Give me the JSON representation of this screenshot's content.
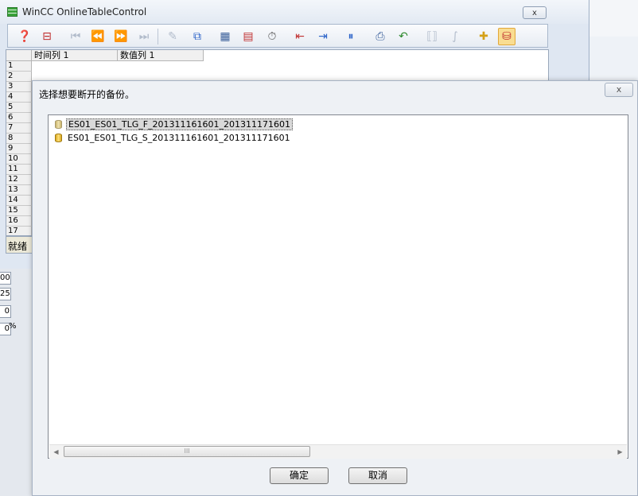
{
  "window": {
    "title": "WinCC OnlineTableControl",
    "close_label": "x"
  },
  "toolbar": {
    "icons": [
      "help-icon",
      "config-icon",
      "first-icon",
      "prev-page-icon",
      "next-page-icon",
      "last-icon",
      "edit-icon",
      "copy-icon",
      "select-columns-icon",
      "select-table-icon",
      "time-range-icon",
      "prev-column-icon",
      "next-column-icon",
      "pause-icon",
      "print-icon",
      "export-icon",
      "select-data-icon",
      "calculate-icon",
      "connect-backup-icon",
      "disconnect-backup-icon"
    ]
  },
  "grid": {
    "columns": [
      "时间列 1",
      "数值列 1"
    ],
    "rows": [
      "1",
      "2",
      "3",
      "4",
      "5",
      "6",
      "7",
      "8",
      "9",
      "10",
      "11",
      "12",
      "13",
      "14",
      "15",
      "16",
      "17"
    ]
  },
  "status": {
    "text": "就绪"
  },
  "left_fields": [
    "00",
    "25",
    "0",
    "0"
  ],
  "left_percent": "%",
  "dialog": {
    "title": "选择想要断开的备份。",
    "close_label": "x",
    "items": [
      {
        "label": "ES01_ES01_TLG_F_201311161601_201311171601",
        "selected": true
      },
      {
        "label": "ES01_ES01_TLG_S_201311161601_201311171601",
        "selected": false
      }
    ],
    "scroll_left": "◀",
    "scroll_right": "▶",
    "scroll_grip": "III",
    "ok_label": "确定",
    "cancel_label": "取消"
  }
}
